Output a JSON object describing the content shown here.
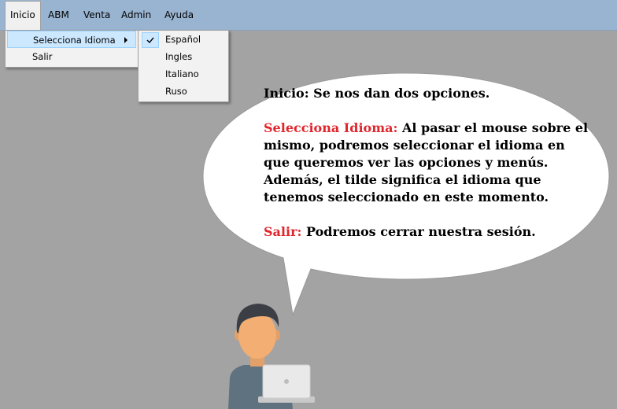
{
  "menubar": {
    "items": [
      {
        "label": "Inicio"
      },
      {
        "label": "ABM"
      },
      {
        "label": "Venta"
      },
      {
        "label": "Admin"
      },
      {
        "label": "Ayuda"
      }
    ]
  },
  "inicio_menu": {
    "items": [
      {
        "label": "Selecciona Idioma"
      },
      {
        "label": "Salir"
      }
    ]
  },
  "language_menu": {
    "items": [
      {
        "label": "Español",
        "checked": true
      },
      {
        "label": "Ingles"
      },
      {
        "label": "Italiano"
      },
      {
        "label": "Ruso"
      }
    ]
  },
  "bubble": {
    "line1": "Inicio: Se nos dan dos opciones.",
    "p2_highlight": "Selecciona Idioma:",
    "p2_text": " Al pasar el mouse sobre el mismo, podremos seleccionar el idioma en que queremos ver las opciones y menús. Además, el tilde significa el idioma que tenemos seleccionado en este momento.",
    "p3_highlight": "Salir:",
    "p3_text": " Podremos cerrar nuestra sesión."
  },
  "colors": {
    "menubar": "#99b4d1",
    "background": "#a3a3a3",
    "highlight": "#e0262d"
  }
}
